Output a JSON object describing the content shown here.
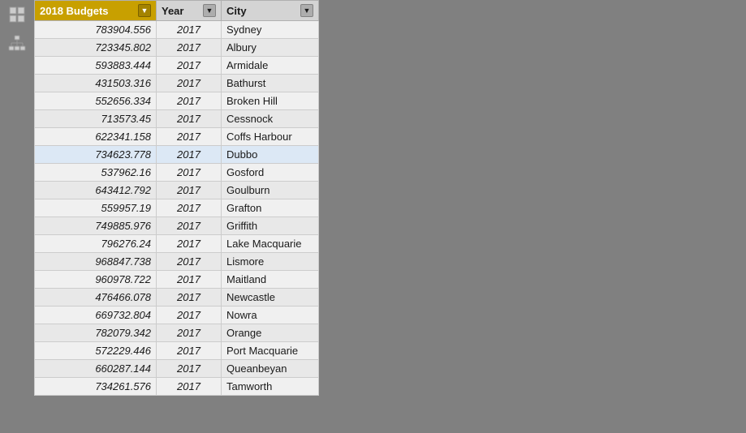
{
  "table": {
    "columns": [
      {
        "key": "budgets",
        "label": "2018 Budgets",
        "class": "col-budgets"
      },
      {
        "key": "year",
        "label": "Year",
        "class": "col-year"
      },
      {
        "key": "city",
        "label": "City",
        "class": "col-city"
      }
    ],
    "rows": [
      {
        "budgets": "783904.556",
        "year": "2017",
        "city": "Sydney"
      },
      {
        "budgets": "723345.802",
        "year": "2017",
        "city": "Albury"
      },
      {
        "budgets": "593883.444",
        "year": "2017",
        "city": "Armidale"
      },
      {
        "budgets": "431503.316",
        "year": "2017",
        "city": "Bathurst"
      },
      {
        "budgets": "552656.334",
        "year": "2017",
        "city": "Broken Hill"
      },
      {
        "budgets": "713573.45",
        "year": "2017",
        "city": "Cessnock"
      },
      {
        "budgets": "622341.158",
        "year": "2017",
        "city": "Coffs Harbour"
      },
      {
        "budgets": "734623.778",
        "year": "2017",
        "city": "Dubbo",
        "cursor": true
      },
      {
        "budgets": "537962.16",
        "year": "2017",
        "city": "Gosford"
      },
      {
        "budgets": "643412.792",
        "year": "2017",
        "city": "Goulburn"
      },
      {
        "budgets": "559957.19",
        "year": "2017",
        "city": "Grafton"
      },
      {
        "budgets": "749885.976",
        "year": "2017",
        "city": "Griffith"
      },
      {
        "budgets": "796276.24",
        "year": "2017",
        "city": "Lake Macquarie"
      },
      {
        "budgets": "968847.738",
        "year": "2017",
        "city": "Lismore"
      },
      {
        "budgets": "960978.722",
        "year": "2017",
        "city": "Maitland"
      },
      {
        "budgets": "476466.078",
        "year": "2017",
        "city": "Newcastle"
      },
      {
        "budgets": "669732.804",
        "year": "2017",
        "city": "Nowra"
      },
      {
        "budgets": "782079.342",
        "year": "2017",
        "city": "Orange"
      },
      {
        "budgets": "572229.446",
        "year": "2017",
        "city": "Port Macquarie"
      },
      {
        "budgets": "660287.144",
        "year": "2017",
        "city": "Queanbeyan"
      },
      {
        "budgets": "734261.576",
        "year": "2017",
        "city": "Tamworth"
      }
    ]
  },
  "icons": {
    "grid_label": "grid-icon",
    "hierarchy_label": "hierarchy-icon"
  }
}
